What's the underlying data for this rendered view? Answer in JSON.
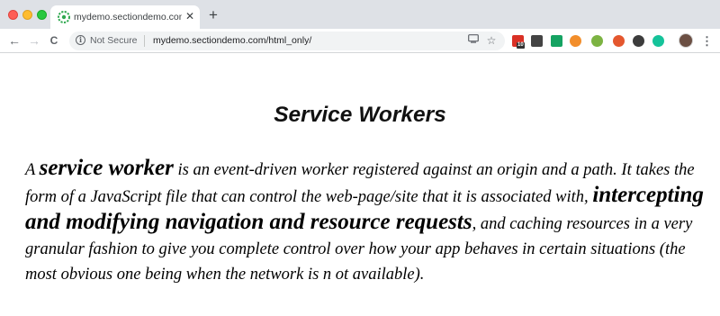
{
  "browser": {
    "tab": {
      "title": "mydemo.sectiondemo.com/html_only/",
      "favicon": "section-logo-icon",
      "close_label": "✕"
    },
    "new_tab_label": "+",
    "nav": {
      "back": "←",
      "forward": "→",
      "reload": "C"
    },
    "address": {
      "security_label": "Not Secure",
      "url": "mydemo.sectiondemo.com/html_only/"
    },
    "extensions": [
      {
        "name": "todo-extension-icon",
        "color": "#d93025",
        "badge": "10"
      },
      {
        "name": "qr-extension-icon",
        "color": "#444444"
      },
      {
        "name": "grammarly-extension-icon",
        "color": "#15a362"
      },
      {
        "name": "honey-extension-icon",
        "color": "#f28e2b"
      },
      {
        "name": "android-extension-icon",
        "color": "#7cb342"
      },
      {
        "name": "fox-extension-icon",
        "color": "#e4572e"
      },
      {
        "name": "record-extension-icon",
        "color": "#3c3c3c"
      },
      {
        "name": "grammarly-circle-extension-icon",
        "color": "#15c39a"
      }
    ]
  },
  "page": {
    "title": "Service Workers",
    "paragraph": {
      "p1": "A ",
      "strong1": "service worker",
      "p2": " is an event-driven worker registered against an origin and a path. It takes the form of a JavaScript file that can control the web-page/site that it is associated with, ",
      "strong2": "intercepting and modifying navigation and resource requests",
      "p3": ", and caching resources in a very granular fashion to give you complete control over how your app behaves in certain situations (the most obvious one being when the network is n ot available)."
    }
  }
}
